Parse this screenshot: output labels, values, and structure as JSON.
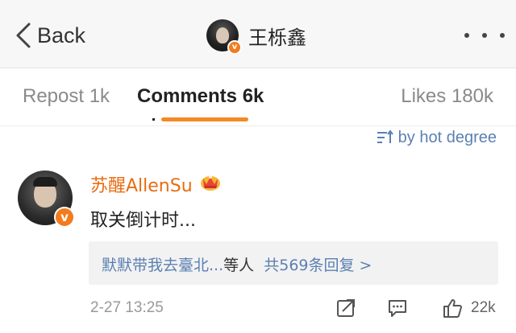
{
  "nav": {
    "back_label": "Back",
    "title": "王栎鑫",
    "verified_mark": "v"
  },
  "tabs": [
    {
      "label": "Repost 1k",
      "active": false
    },
    {
      "label": "Comments 6k",
      "active": true
    },
    {
      "label": "Likes 180k",
      "active": false
    }
  ],
  "sort": {
    "label": "by hot degree",
    "icon": "sort-icon"
  },
  "comment": {
    "username": "苏醒AllenSu",
    "badge_icon": "crown-icon",
    "verified_mark": "v",
    "text": "取关倒计时...",
    "replies": {
      "authors": "默默带我去臺北...",
      "suffix": "等人",
      "count_text": "共569条回复 >"
    },
    "time": "2-27 13:25",
    "likes": "22k"
  },
  "colors": {
    "accent": "#f48a25",
    "username": "#e86c12",
    "link": "#5b80b2",
    "verified": "#f37b1d"
  }
}
